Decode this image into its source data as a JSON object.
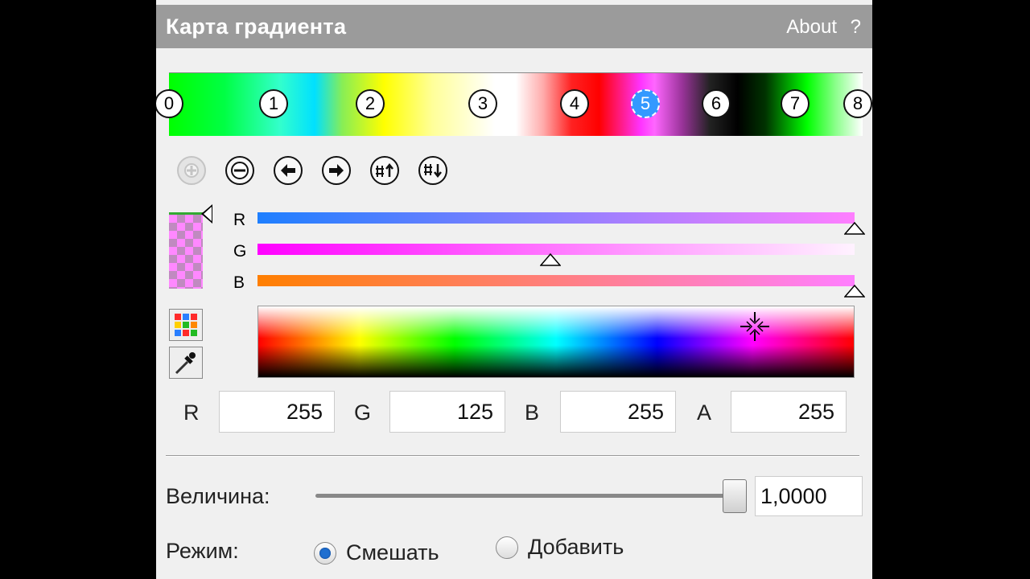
{
  "window": {
    "title": "Карта градиента",
    "about_label": "About",
    "help_label": "?"
  },
  "gradient": {
    "stops": [
      {
        "label": "0",
        "selected": false
      },
      {
        "label": "1",
        "selected": false
      },
      {
        "label": "2",
        "selected": false
      },
      {
        "label": "3",
        "selected": false
      },
      {
        "label": "4",
        "selected": false
      },
      {
        "label": "5",
        "selected": true
      },
      {
        "label": "6",
        "selected": false
      },
      {
        "label": "7",
        "selected": false
      },
      {
        "label": "8",
        "selected": false
      }
    ]
  },
  "toolbar": {
    "icons": [
      "add-stop-icon",
      "remove-stop-icon",
      "move-left-icon",
      "move-right-icon",
      "distribute-up-icon",
      "distribute-down-icon"
    ]
  },
  "channels": {
    "r_label": "R",
    "g_label": "G",
    "b_label": "B",
    "r_level": 1.0,
    "g_level": 0.49,
    "b_level": 1.0
  },
  "fields": {
    "r": {
      "label": "R",
      "value": "255"
    },
    "g": {
      "label": "G",
      "value": "125"
    },
    "b": {
      "label": "B",
      "value": "255"
    },
    "a": {
      "label": "A",
      "value": "255"
    }
  },
  "magnitude": {
    "label": "Величина:",
    "value": "1,0000",
    "level": 1.0
  },
  "mode": {
    "label": "Режим:",
    "options": [
      {
        "label": "Смешать",
        "selected": true
      },
      {
        "label": "Добавить",
        "selected": false
      }
    ]
  },
  "colors": {
    "titlebar": "#9b9b9b",
    "panel": "#f0f0f0",
    "selected_stop": "#3399ff",
    "radio_on": "#1f6fd0"
  }
}
